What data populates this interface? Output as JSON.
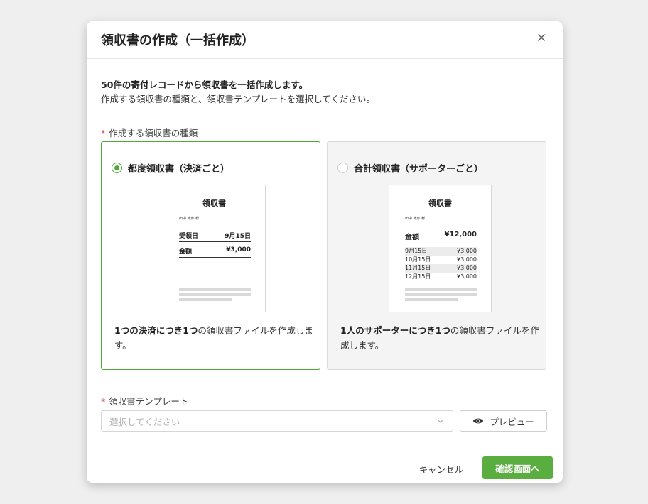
{
  "dialog": {
    "title": "領収書の作成（一括作成）"
  },
  "description": {
    "line1": "50件の寄付レコードから領収書を一括作成します。",
    "line2": "作成する領収書の種類と、領収書テンプレートを選択してください。"
  },
  "receipt_type": {
    "label": "作成する領収書の種類",
    "required_mark": "*",
    "options": [
      {
        "label": "都度領収書（決済ごと）",
        "selected": true,
        "desc_bold": "1つの決済につき1つ",
        "desc_rest": "の領収書ファイルを作成します。",
        "sample": {
          "title": "領収書",
          "name": "田中 太郎 様",
          "rows": [
            {
              "k": "受領日",
              "v": "9月15日"
            },
            {
              "k": "金額",
              "v": "¥3,000"
            }
          ]
        }
      },
      {
        "label": "合計領収書（サポーターごと）",
        "selected": false,
        "desc_bold": "1人のサポーターにつき1つ",
        "desc_rest": "の領収書ファイルを作成します。",
        "sample": {
          "title": "領収書",
          "name": "田中 太郎 様",
          "total": {
            "k": "金額",
            "v": "¥12,000"
          },
          "items": [
            {
              "k": "9月15日",
              "v": "¥3,000"
            },
            {
              "k": "10月15日",
              "v": "¥3,000"
            },
            {
              "k": "11月15日",
              "v": "¥3,000"
            },
            {
              "k": "12月15日",
              "v": "¥3,000"
            }
          ]
        }
      }
    ]
  },
  "template": {
    "label": "領収書テンプレート",
    "required_mark": "*",
    "placeholder": "選択してください",
    "preview_label": "プレビュー"
  },
  "footer": {
    "cancel_label": "キャンセル",
    "confirm_label": "確認画面へ"
  },
  "colors": {
    "accent": "#5aae3f",
    "required": "#d64545"
  }
}
